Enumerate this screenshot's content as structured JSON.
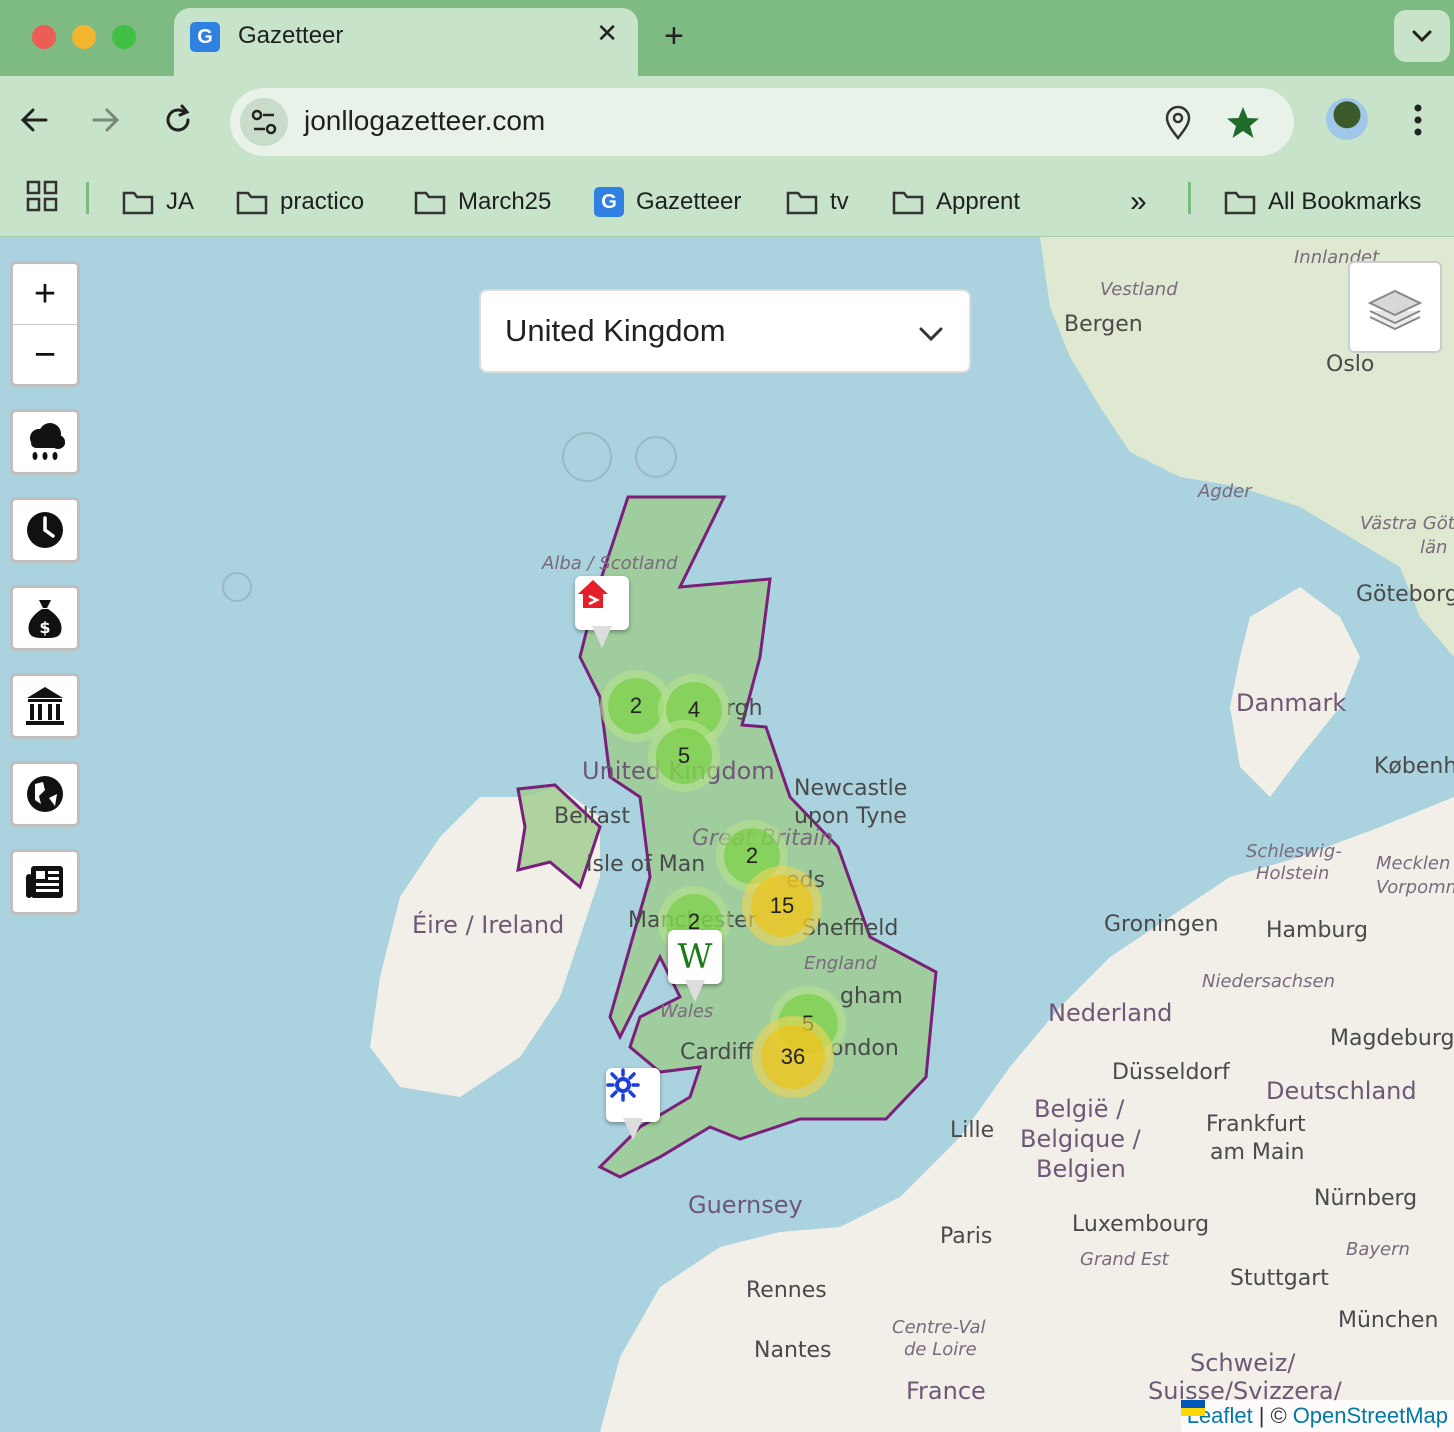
{
  "browser": {
    "tab": {
      "title": "Gazetteer",
      "favicon_letter": "G",
      "close": "✕"
    },
    "new_tab": "+",
    "url": "jonllogazetteer.com",
    "bookmarks": [
      {
        "label": "JA",
        "icon": "folder-icon"
      },
      {
        "label": "practico",
        "icon": "folder-icon"
      },
      {
        "label": "March25",
        "icon": "folder-icon"
      },
      {
        "label": "Gazetteer",
        "icon": "gazetteer-favicon"
      },
      {
        "label": "tv",
        "icon": "folder-icon"
      },
      {
        "label": "Apprent",
        "icon": "folder-icon"
      }
    ],
    "more_bookmarks": "»",
    "all_bookmarks": "All Bookmarks"
  },
  "map": {
    "country_select": {
      "value": "United Kingdom"
    },
    "zoom": {
      "in": "+",
      "out": "−"
    },
    "side_buttons": [
      "weather-icon",
      "clock-icon",
      "money-bag-icon",
      "bank-icon",
      "globe-icon",
      "newspaper-icon"
    ],
    "clusters": [
      {
        "count": "2",
        "level": "green"
      },
      {
        "count": "4",
        "level": "green"
      },
      {
        "count": "5",
        "level": "green"
      },
      {
        "count": "2",
        "level": "green"
      },
      {
        "count": "15",
        "level": "yellow"
      },
      {
        "count": "2",
        "level": "green"
      },
      {
        "count": "5",
        "level": "green"
      },
      {
        "count": "36",
        "level": "yellow"
      }
    ],
    "markers": {
      "wiki_letter": "W"
    },
    "labels": {
      "vestland": "Vestland",
      "innlandet": "Innlandet",
      "bergen": "Bergen",
      "oslo": "Oslo",
      "agder": "Agder",
      "vastra": "Västra Göt",
      "lan": "län",
      "goteborg": "Göteborg",
      "danmark": "Danmark",
      "kobenh": "Københ",
      "scotland": "Alba / Scotland",
      "edinburgh": "rgh",
      "uk": "United Kingdom",
      "newcastle1": "Newcastle",
      "newcastle2": "upon Tyne",
      "belfast": "Belfast",
      "gb": "Great Britain",
      "isle_man": "Isle of Man",
      "ireland": "Éire / Ireland",
      "leeds": "eds",
      "manchester": "Manchester",
      "sheffield": "Sheffield",
      "england": "England",
      "birmingham": "gham",
      "wales": "Wales",
      "cardiff": "Cardiff",
      "london": "ondon",
      "schleswig1": "Schleswig-",
      "schleswig2": "Holstein",
      "mecklen1": "Mecklen",
      "mecklen2": "Vorpomm",
      "groningen": "Groningen",
      "hamburg": "Hamburg",
      "niedersachsen": "Niedersachsen",
      "nederland": "Nederland",
      "magdeburg": "Magdeburg",
      "dusseldorf": "Düsseldorf",
      "deutschland": "Deutschland",
      "lille": "Lille",
      "belgie1": "België /",
      "belgie2": "Belgique /",
      "belgie3": "Belgien",
      "frankfurt1": "Frankfurt",
      "frankfurt2": "am Main",
      "nurnberg": "Nürnberg",
      "luxembourg": "Luxembourg",
      "grandest": "Grand Est",
      "bayern": "Bayern",
      "guernsey": "Guernsey",
      "paris": "Paris",
      "stuttgart": "Stuttgart",
      "rennes": "Rennes",
      "centre1": "Centre-Val",
      "centre2": "de Loire",
      "munchen": "München",
      "nantes": "Nantes",
      "france": "France",
      "schweiz1": "Schweiz/",
      "schweiz2": "Suisse/Svizzera/"
    },
    "attribution": {
      "leaflet": "Leaflet",
      "sep": "|",
      "copy": "©",
      "osm": "OpenStreetMap"
    }
  },
  "colors": {
    "chrome_dark": "#7dbb82",
    "chrome_light": "#c7e3c9",
    "water": "#aad3df",
    "land": "#f2efe9",
    "uk_fill": "#9ccc8c",
    "uk_border": "#7a1f7a"
  }
}
